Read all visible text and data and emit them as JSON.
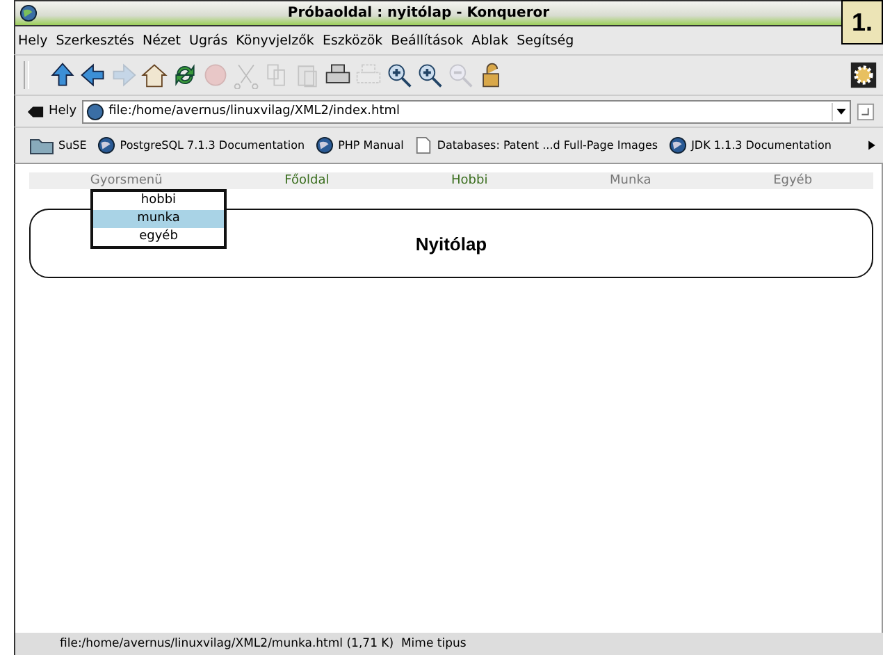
{
  "window": {
    "title": "Próbaoldal : nyitólap - Konqueror",
    "badge": "1."
  },
  "menu": [
    "Hely",
    "Szerkesztés",
    "Nézet",
    "Ugrás",
    "Könyvjelzők",
    "Eszközök",
    "Beállítások",
    "Ablak",
    "Segítség"
  ],
  "toolbar": [
    {
      "kind": "up",
      "disabled": false
    },
    {
      "kind": "back",
      "disabled": false
    },
    {
      "kind": "forward",
      "disabled": true
    },
    {
      "kind": "home",
      "disabled": false
    },
    {
      "kind": "reload",
      "disabled": false
    },
    {
      "kind": "stop",
      "disabled": true
    },
    {
      "kind": "cut",
      "disabled": true
    },
    {
      "kind": "copy",
      "disabled": true
    },
    {
      "kind": "paste",
      "disabled": true
    },
    {
      "kind": "print",
      "disabled": false
    },
    {
      "kind": "printframe",
      "disabled": true
    },
    {
      "kind": "zoomin",
      "disabled": false
    },
    {
      "kind": "zoomin",
      "disabled": false
    },
    {
      "kind": "zoomout",
      "disabled": true
    },
    {
      "kind": "lock",
      "disabled": false
    }
  ],
  "location": {
    "label": "Hely",
    "value": "file:/home/avernus/linuxvilag/XML2/index.html"
  },
  "bookmarks": [
    {
      "kind": "folder",
      "label": "SuSE"
    },
    {
      "kind": "globe",
      "label": "PostgreSQL 7.1.3 Documentation"
    },
    {
      "kind": "globe",
      "label": "PHP Manual"
    },
    {
      "kind": "doc",
      "label": "Databases: Patent ...d Full-Page Images"
    },
    {
      "kind": "globe",
      "label": "JDK 1.1.3 Documentation"
    }
  ],
  "page": {
    "nav": [
      {
        "label": "Gyorsmenü",
        "color": "#777777"
      },
      {
        "label": "Főoldal",
        "color": "#3a6e1e"
      },
      {
        "label": "Hobbi",
        "color": "#3a6e1e"
      },
      {
        "label": "Munka",
        "color": "#777777"
      },
      {
        "label": "Egyéb",
        "color": "#777777"
      }
    ],
    "popup": [
      {
        "label": "hobbi",
        "selected": false
      },
      {
        "label": "munka",
        "selected": true
      },
      {
        "label": "egyéb",
        "selected": false
      }
    ],
    "heading": "Nyitólap"
  },
  "status_bar": "file:/home/avernus/linuxvilag/XML2/munka.html (1,71 K)  Mime tipus"
}
